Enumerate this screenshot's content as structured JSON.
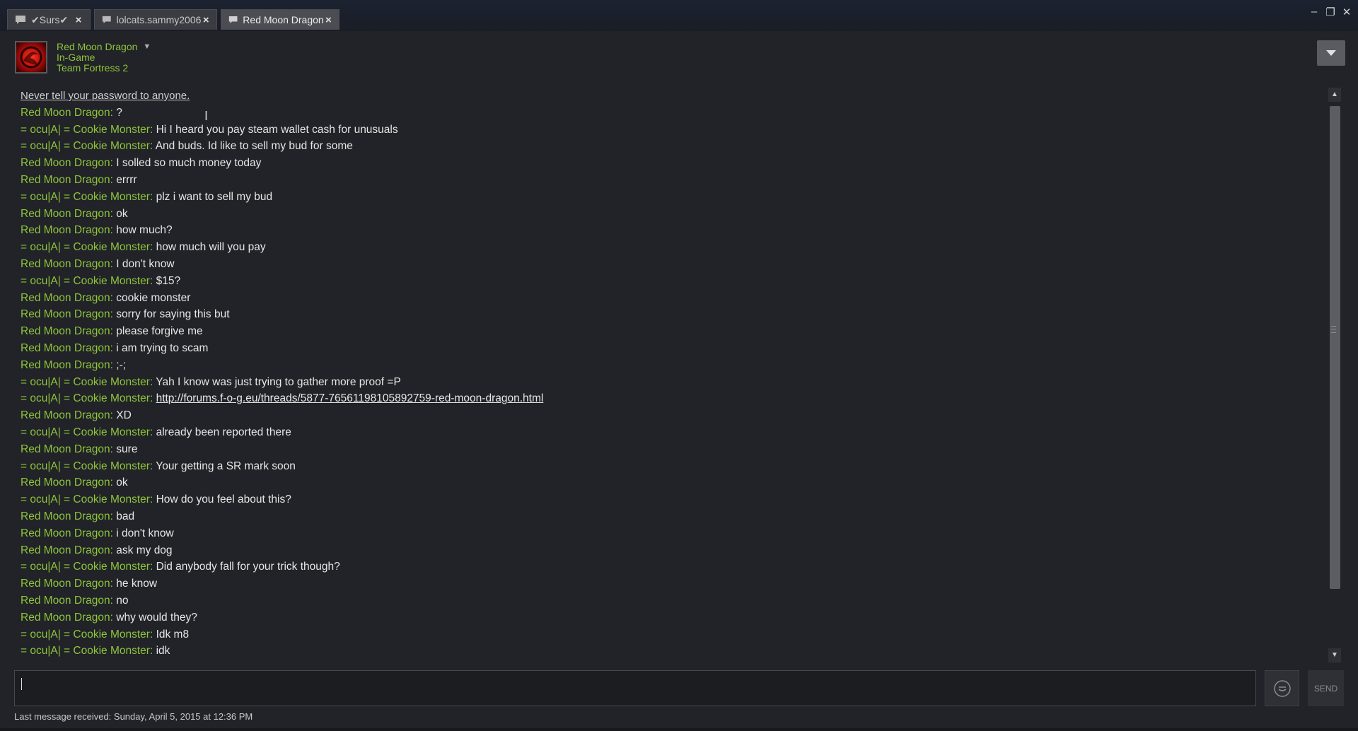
{
  "tabs": [
    {
      "label": "✔Surs✔",
      "active": false
    },
    {
      "label": "lolcats.sammy2006",
      "active": false
    },
    {
      "label": "Red Moon Dragon",
      "active": true
    }
  ],
  "window_controls": {
    "minimize": "–",
    "restore": "❐",
    "close": "✕"
  },
  "friend": {
    "name": "Red Moon Dragon",
    "status": "In-Game",
    "game": "Team Fortress 2"
  },
  "notice": "Never tell your password to anyone.",
  "messages": [
    {
      "sender": "Red Moon Dragon",
      "text": "?"
    },
    {
      "sender": "= ocu|A| = Cookie Monster",
      "text": "Hi I heard you pay steam wallet cash for unusuals"
    },
    {
      "sender": "= ocu|A| = Cookie Monster",
      "text": "And buds. Id like to sell my bud for some"
    },
    {
      "sender": "Red Moon Dragon",
      "text": "I solled so much money today"
    },
    {
      "sender": "Red Moon Dragon",
      "text": "errrr"
    },
    {
      "sender": "= ocu|A| = Cookie Monster",
      "text": "plz i want to sell my bud"
    },
    {
      "sender": "Red Moon Dragon",
      "text": "ok"
    },
    {
      "sender": "Red Moon Dragon",
      "text": "how much?"
    },
    {
      "sender": "= ocu|A| = Cookie Monster",
      "text": "how much will you pay"
    },
    {
      "sender": "Red Moon Dragon",
      "text": "I don't know"
    },
    {
      "sender": "= ocu|A| = Cookie Monster",
      "text": "$15?"
    },
    {
      "sender": "Red Moon Dragon",
      "text": "cookie monster"
    },
    {
      "sender": "Red Moon Dragon",
      "text": "sorry for saying this but"
    },
    {
      "sender": "Red Moon Dragon",
      "text": "please forgive me"
    },
    {
      "sender": "Red Moon Dragon",
      "text": "i am trying to scam"
    },
    {
      "sender": "Red Moon Dragon",
      "text": ";-;"
    },
    {
      "sender": "= ocu|A| = Cookie Monster",
      "text": "Yah I know was just trying to gather more proof =P"
    },
    {
      "sender": "= ocu|A| = Cookie Monster",
      "text": "http://forums.f-o-g.eu/threads/5877-76561198105892759-red-moon-dragon.html",
      "link": true
    },
    {
      "sender": "Red Moon Dragon",
      "text": "XD"
    },
    {
      "sender": "= ocu|A| = Cookie Monster",
      "text": "already been reported there"
    },
    {
      "sender": "Red Moon Dragon",
      "text": "sure"
    },
    {
      "sender": "= ocu|A| = Cookie Monster",
      "text": "Your getting a SR mark soon"
    },
    {
      "sender": "Red Moon Dragon",
      "text": "ok"
    },
    {
      "sender": "= ocu|A| = Cookie Monster",
      "text": "How do you feel about this?"
    },
    {
      "sender": "Red Moon Dragon",
      "text": "bad"
    },
    {
      "sender": "Red Moon Dragon",
      "text": "i don't know"
    },
    {
      "sender": "Red Moon Dragon",
      "text": "ask my dog"
    },
    {
      "sender": "= ocu|A| = Cookie Monster",
      "text": "Did anybody fall for your trick though?"
    },
    {
      "sender": "Red Moon Dragon",
      "text": "he know"
    },
    {
      "sender": "Red Moon Dragon",
      "text": "no"
    },
    {
      "sender": "Red Moon Dragon",
      "text": "why would they?"
    },
    {
      "sender": "= ocu|A| = Cookie Monster",
      "text": "Idk m8"
    },
    {
      "sender": "= ocu|A| = Cookie Monster",
      "text": "idk"
    }
  ],
  "input": {
    "value": "",
    "placeholder": ""
  },
  "send_label": "SEND",
  "footer": "Last message received: Sunday, April 5, 2015 at 12:36 PM",
  "colors": {
    "sender": "#8fc43c",
    "text": "#e6e6e6",
    "background": "#212328"
  }
}
